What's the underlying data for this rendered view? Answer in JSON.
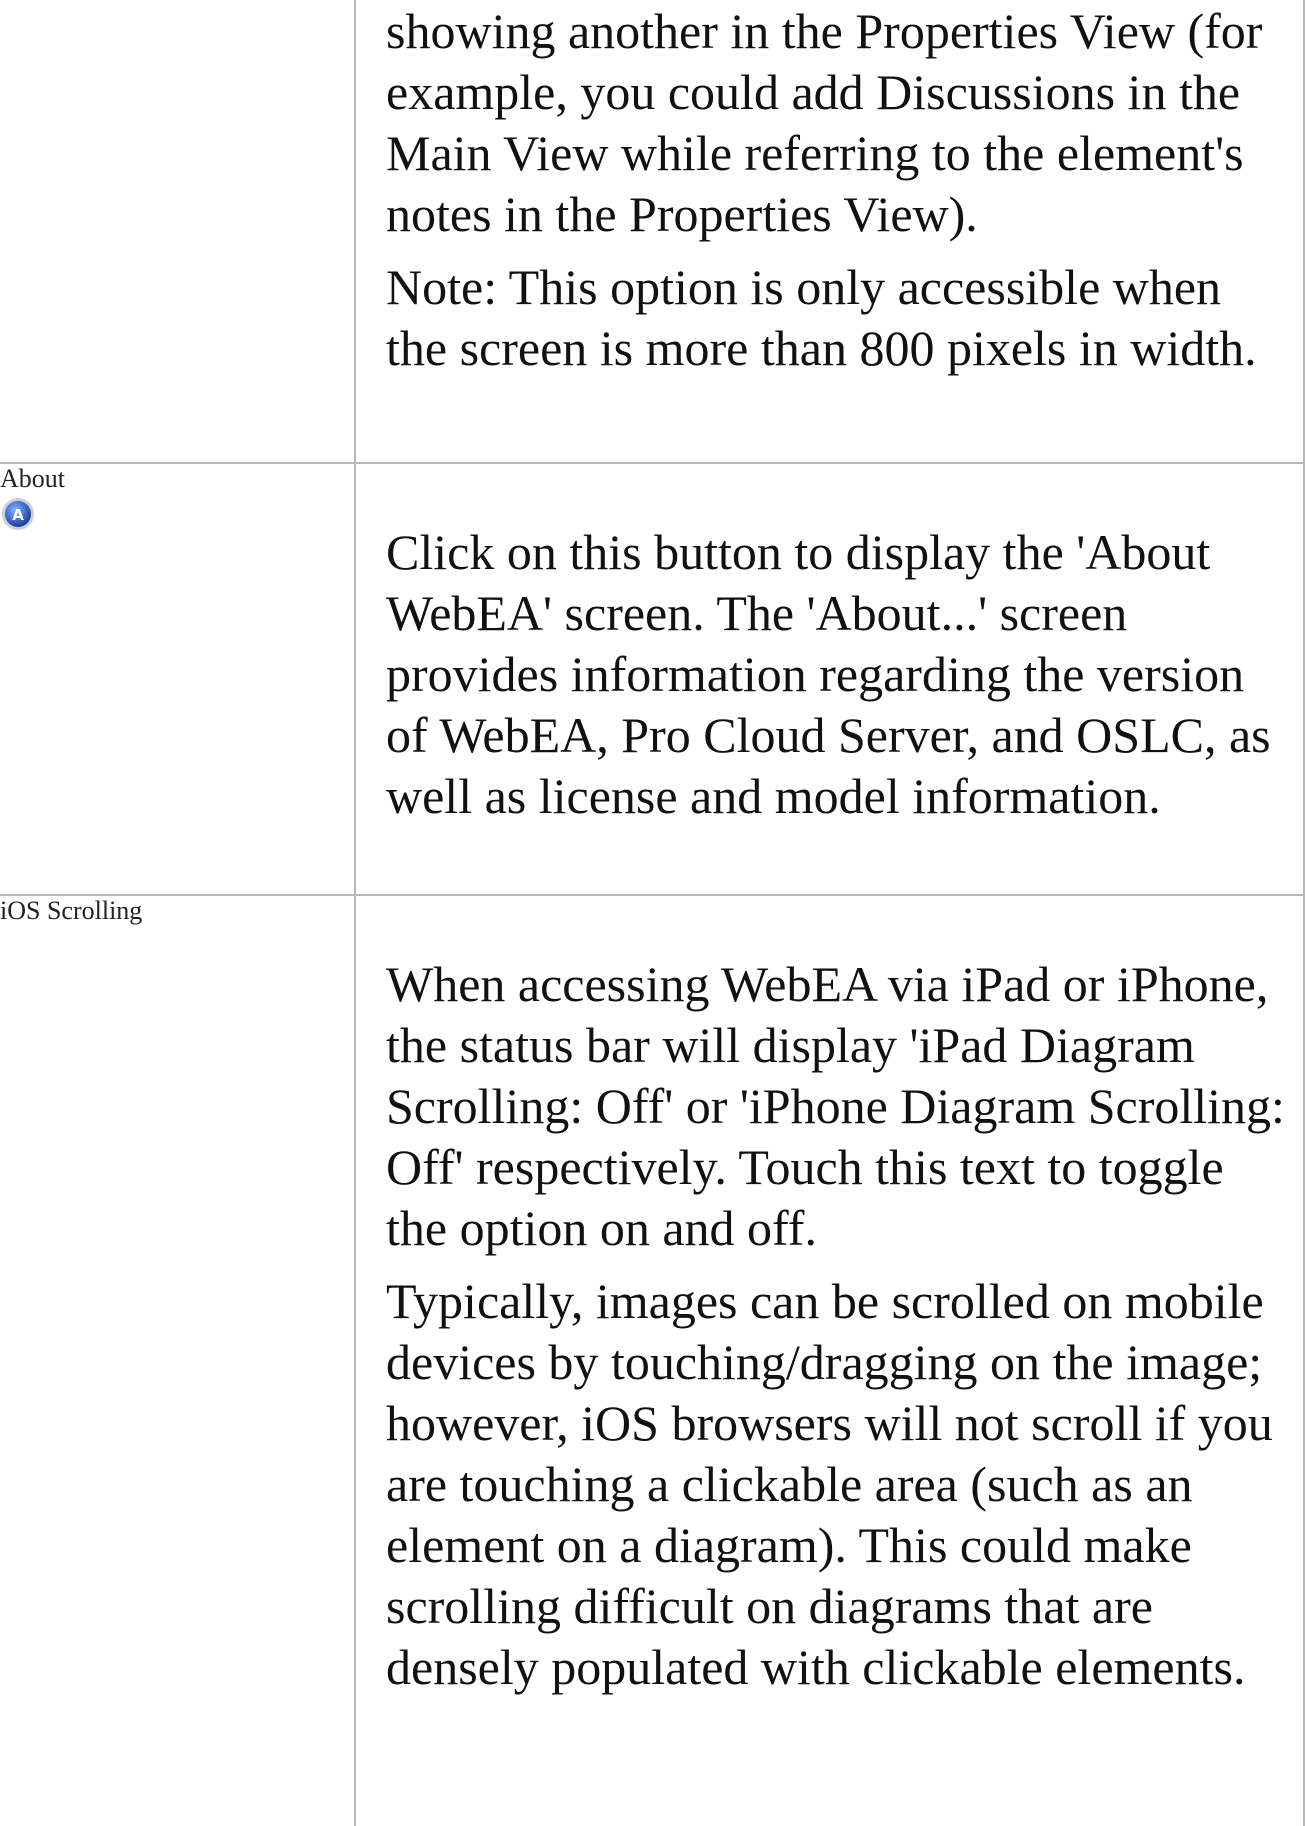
{
  "rows": [
    {
      "label": "",
      "paragraphs": [
        "showing another in the Properties View (for example, you could add Discussions in the Main View while referring to the element's notes in the Properties View).",
        "Note: This option is only accessible when the screen is more than 800 pixels in width."
      ]
    },
    {
      "label": "About",
      "icon": "about-icon",
      "paragraphs": [
        "Click on this button to display the 'About WebEA' screen. The 'About...' screen provides information regarding the version of WebEA, Pro Cloud Server, and OSLC, as well as license and model information."
      ]
    },
    {
      "label": "iOS Scrolling",
      "paragraphs": [
        "When accessing WebEA via iPad or iPhone, the status bar will display 'iPad Diagram Scrolling: Off' or 'iPhone Diagram Scrolling: Off' respectively. Touch this text to toggle the option on and off.",
        "Typically, images can be scrolled on mobile devices by touching/dragging on the image; however, iOS browsers will not scroll if you are touching a clickable area (such as an element on a diagram). This could make scrolling difficult on diagrams that are densely populated with clickable elements."
      ]
    }
  ],
  "colors": {
    "border": "#b8b8b8",
    "text": "#111111",
    "icon_blue": "#3d6fd0"
  }
}
